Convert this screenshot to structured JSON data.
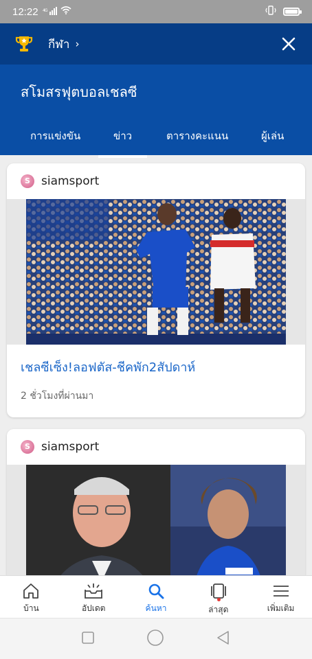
{
  "status_bar": {
    "time": "12:22",
    "signal": "4G"
  },
  "top_bar": {
    "sport_label": "กีฬา",
    "chevron": "›"
  },
  "header": {
    "title": "สโมสรฟุตบอลเชลซี",
    "tabs": [
      {
        "label": "การแข่งขัน"
      },
      {
        "label": "ข่าว",
        "active": true
      },
      {
        "label": "ตารางคะแนน"
      },
      {
        "label": "ผู้เล่น"
      }
    ]
  },
  "feed": {
    "cards": [
      {
        "source": "siamsport",
        "headline": "เชลซีเซ็ง!ลอฟตัส-ชีคพัก2สัปดาห์",
        "time": "2 ชั่วโมงที่ผ่านมา"
      },
      {
        "source": "siamsport"
      }
    ]
  },
  "bottom_nav": [
    {
      "label": "บ้าน",
      "icon": "home-icon"
    },
    {
      "label": "อัปเดต",
      "icon": "inbox-update-icon"
    },
    {
      "label": "ค้นหา",
      "icon": "search-icon",
      "active": true
    },
    {
      "label": "ล่าสุด",
      "icon": "recent-cards-icon"
    },
    {
      "label": "เพิ่มเติม",
      "icon": "menu-icon"
    }
  ],
  "colors": {
    "top_bar": "#063d86",
    "header": "#0a4ea5",
    "accent": "#1a73e8",
    "headline": "#1a66c8"
  }
}
